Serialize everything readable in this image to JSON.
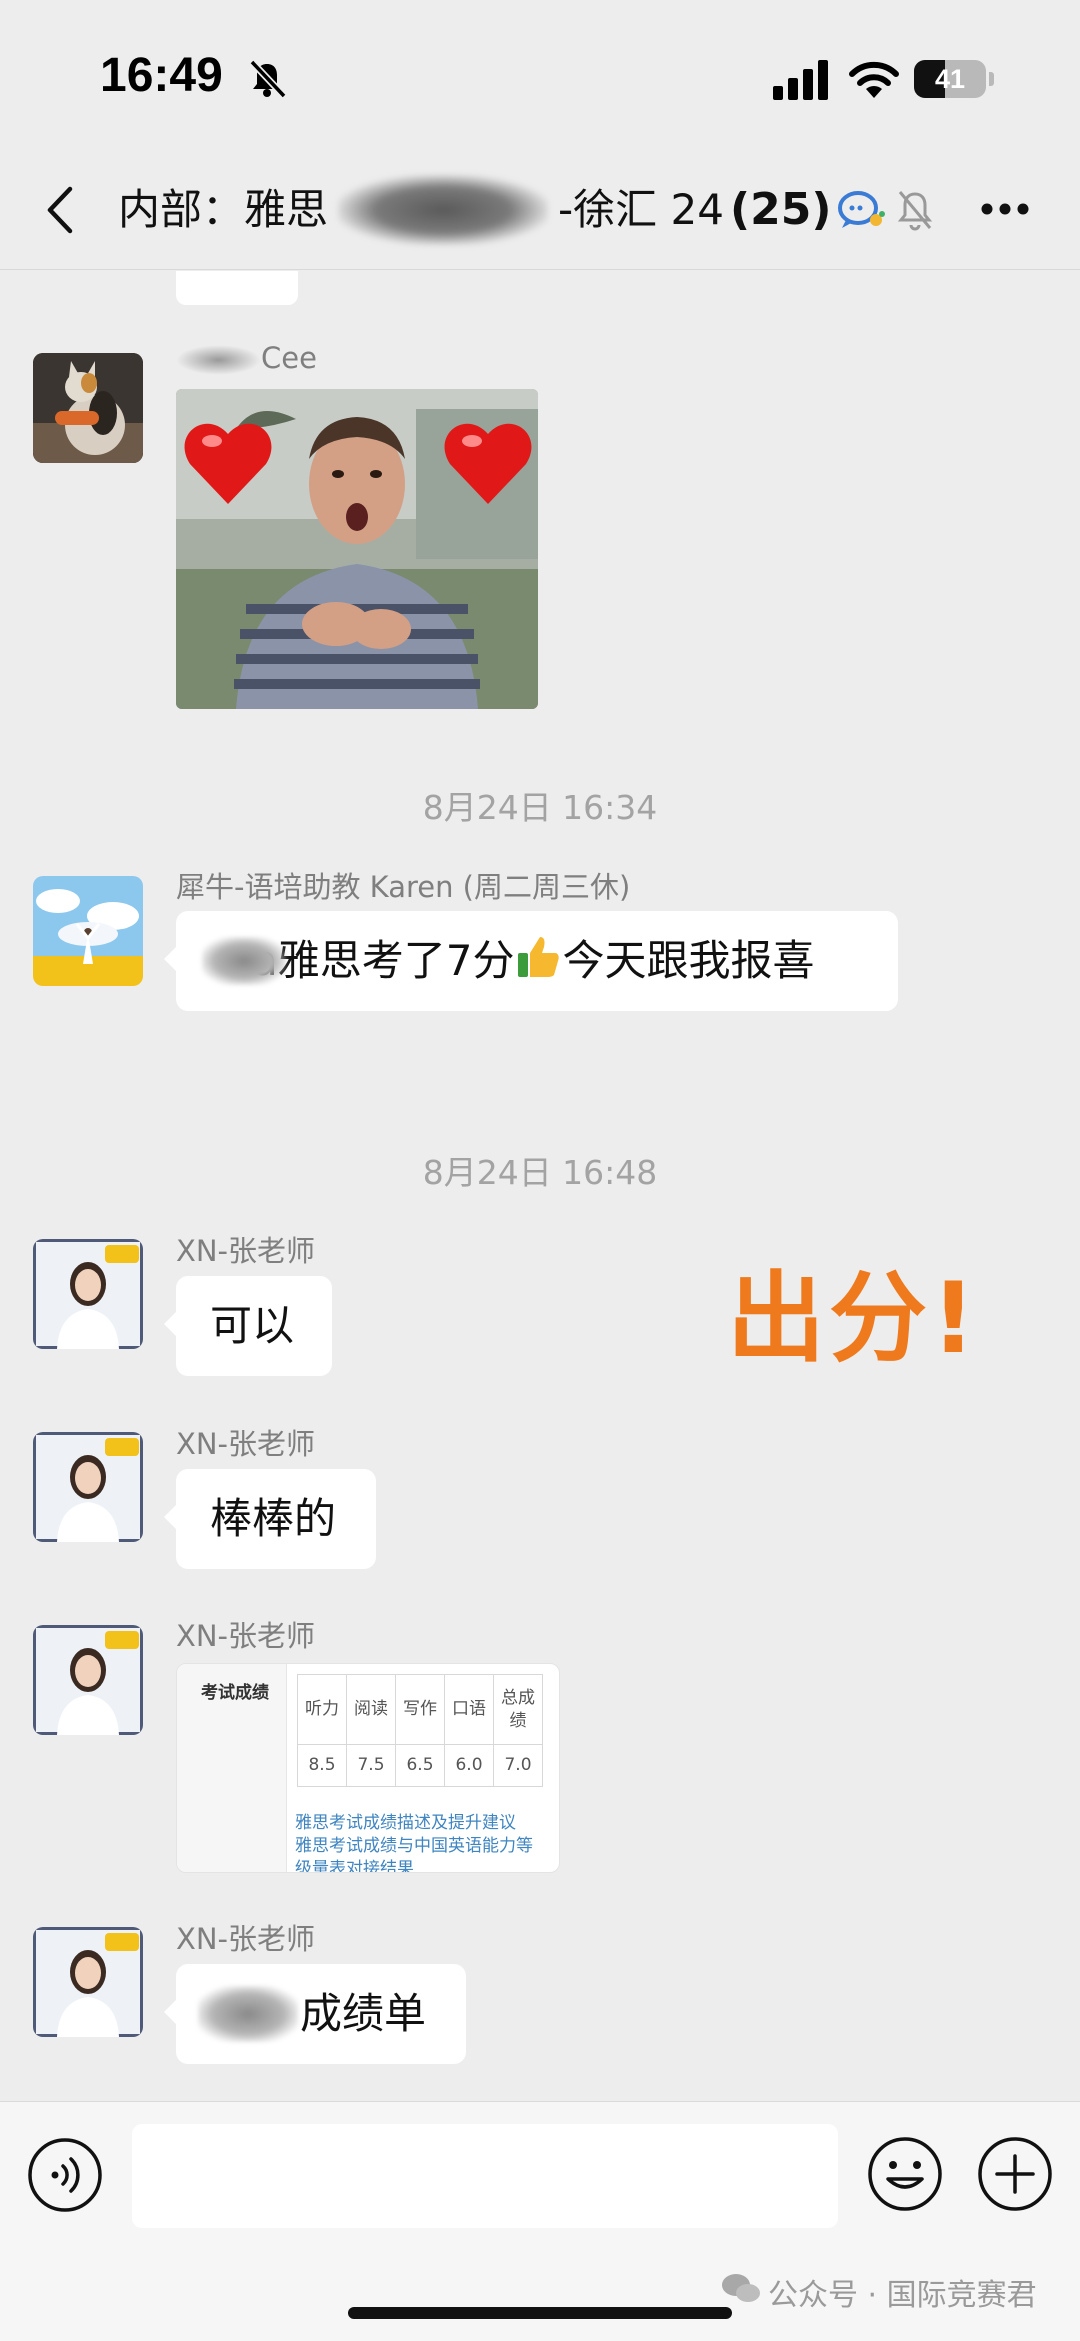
{
  "status_bar": {
    "time": "16:49",
    "battery": "41"
  },
  "header": {
    "title_prefix": "内部：雅思",
    "title_suffix": "-徐汇 24",
    "member_count": "(25)"
  },
  "messages": [
    {
      "sender": "Cee",
      "type": "image"
    },
    {
      "type": "time",
      "text": "8月24日 16:34"
    },
    {
      "sender": "犀牛-语培助教 Karen (周二周三休)",
      "type": "text",
      "text_a": "a雅思考了7分",
      "text_b": "今天跟我报喜"
    },
    {
      "type": "time",
      "text": "8月24日 16:48"
    },
    {
      "sender": "XN-张老师",
      "type": "text",
      "text": "可以"
    },
    {
      "sender": "XN-张老师",
      "type": "text",
      "text": "棒棒的"
    },
    {
      "sender": "XN-张老师",
      "type": "card"
    },
    {
      "sender": "XN-张老师",
      "type": "text",
      "text": "成绩单"
    }
  ],
  "overlay": "出分!",
  "score_card": {
    "side_title": "考试成绩",
    "headers": [
      "听力",
      "阅读",
      "写作",
      "口语",
      "总成绩"
    ],
    "values": [
      "8.5",
      "7.5",
      "6.5",
      "6.0",
      "7.0"
    ],
    "link1": "雅思考试成绩描述及提升建议",
    "link2": "雅思考试成绩与中国英语能力等",
    "link3": "级量表对接结果"
  },
  "watermark": "公众号 · 国际竞赛君",
  "colors": {
    "background": "#ededed",
    "bubble": "#ffffff",
    "overlay": "#ef7a1d",
    "link": "#3f85c1"
  }
}
